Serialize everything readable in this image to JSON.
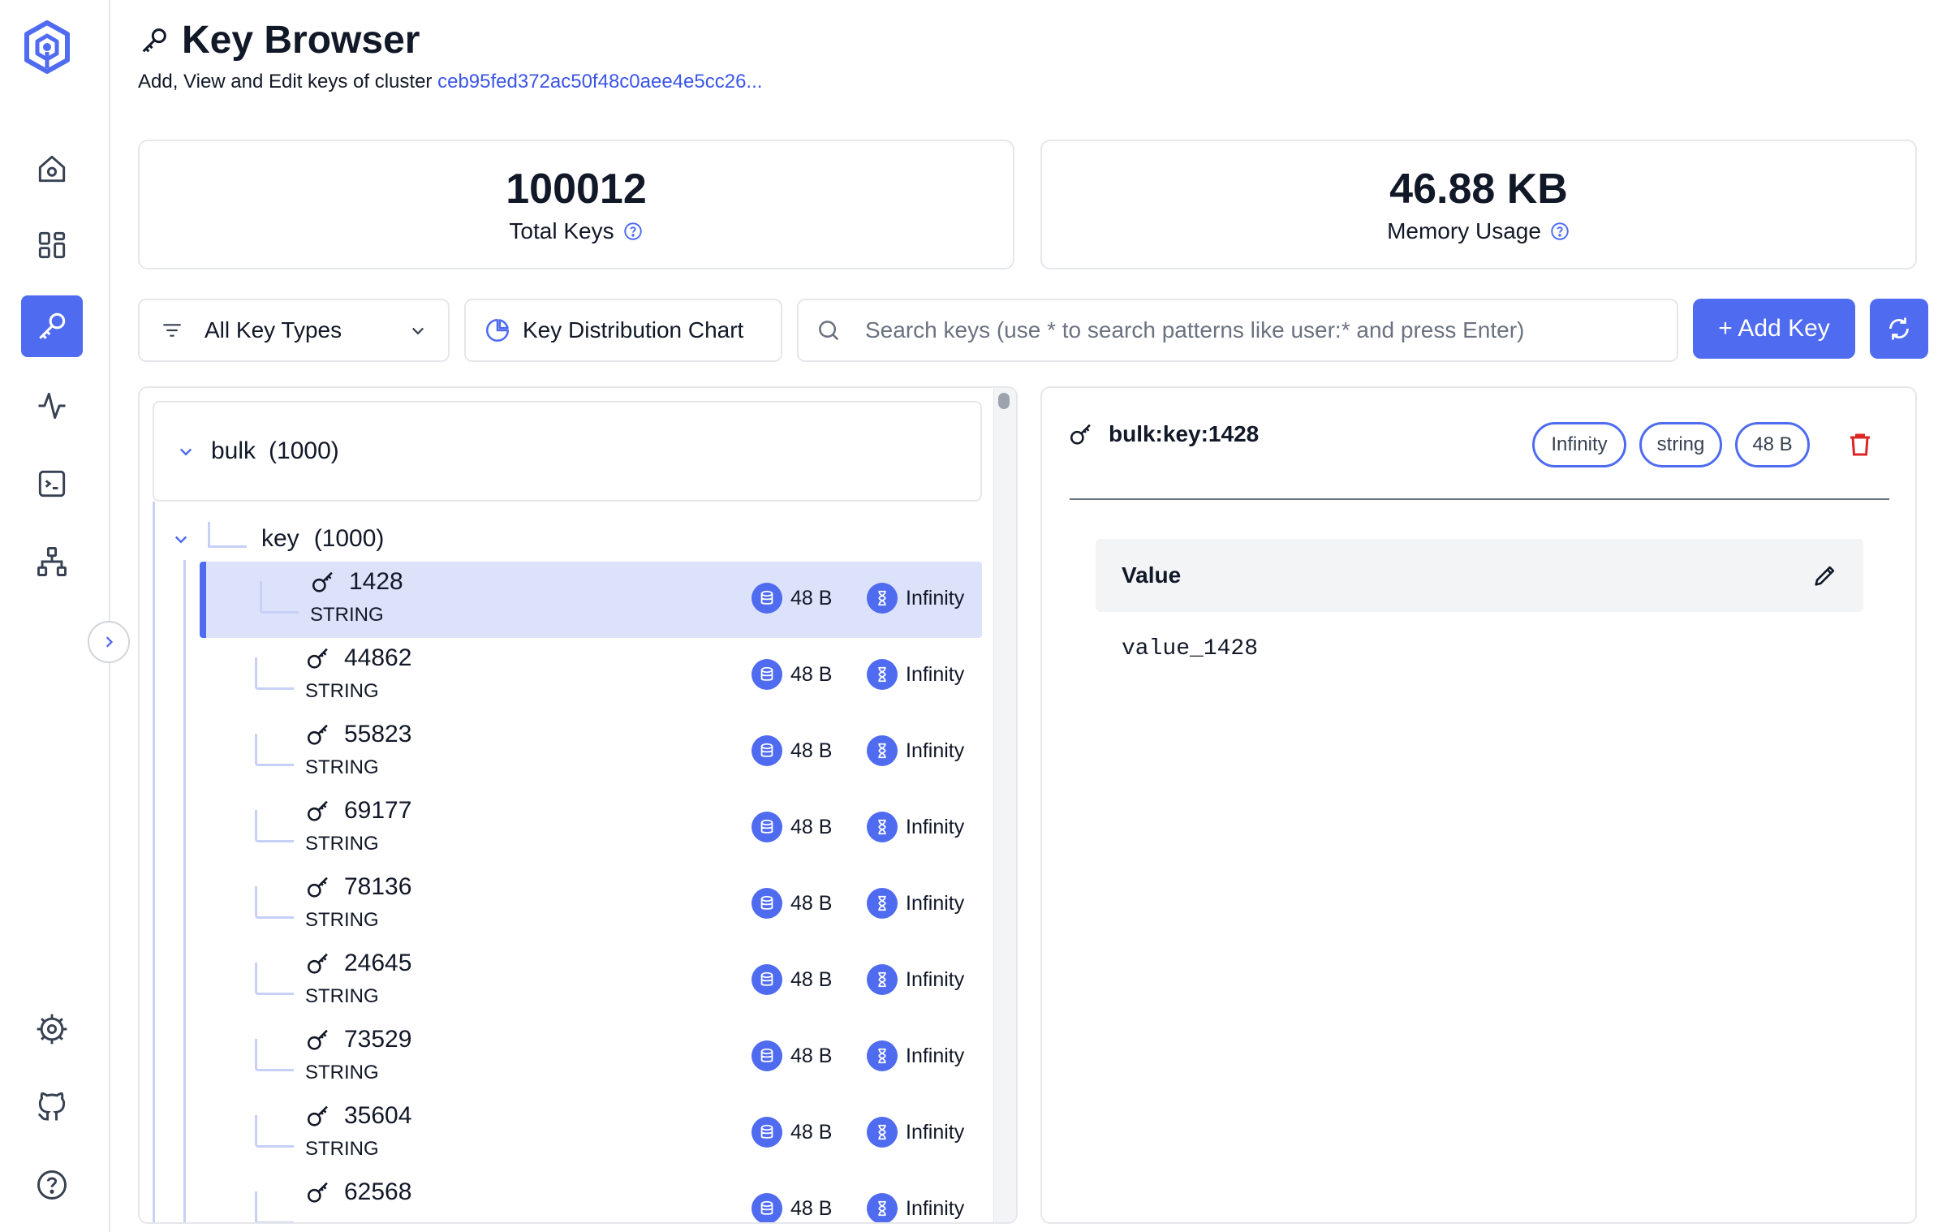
{
  "header": {
    "title": "Key Browser",
    "subtitle": "Add, View and Edit keys of cluster",
    "cluster_id": "ceb95fed372ac50f48c0aee4e5cc26..."
  },
  "stats": {
    "total_keys": "100012",
    "total_keys_label": "Total Keys",
    "memory": "46.88 KB",
    "memory_label": "Memory Usage"
  },
  "toolbar": {
    "key_type_filter": "All Key Types",
    "chart_button": "Key Distribution Chart",
    "search_placeholder": "Search keys (use * to search patterns like user:* and press Enter)",
    "add_key": "+ Add Key"
  },
  "tree": {
    "group": {
      "label": "bulk",
      "count": "(1000)"
    },
    "subgroup": {
      "label": "key",
      "count": "(1000)"
    },
    "keys": [
      {
        "name": "1428",
        "type": "STRING",
        "size": "48 B",
        "ttl": "Infinity",
        "selected": true
      },
      {
        "name": "44862",
        "type": "STRING",
        "size": "48 B",
        "ttl": "Infinity"
      },
      {
        "name": "55823",
        "type": "STRING",
        "size": "48 B",
        "ttl": "Infinity"
      },
      {
        "name": "69177",
        "type": "STRING",
        "size": "48 B",
        "ttl": "Infinity"
      },
      {
        "name": "78136",
        "type": "STRING",
        "size": "48 B",
        "ttl": "Infinity"
      },
      {
        "name": "24645",
        "type": "STRING",
        "size": "48 B",
        "ttl": "Infinity"
      },
      {
        "name": "73529",
        "type": "STRING",
        "size": "48 B",
        "ttl": "Infinity"
      },
      {
        "name": "35604",
        "type": "STRING",
        "size": "48 B",
        "ttl": "Infinity"
      },
      {
        "name": "62568",
        "type": "",
        "size": "48 B",
        "ttl": "Infinity"
      }
    ]
  },
  "detail": {
    "key": "bulk:key:1428",
    "ttl_badge": "Infinity",
    "type_badge": "string",
    "size_badge": "48 B",
    "value_title": "Value",
    "value": "value_1428"
  },
  "colors": {
    "accent": "#4f6bf0",
    "danger": "#dc2626",
    "selected_row": "#dde2fb"
  },
  "icons": {
    "sidebar": [
      "logo-icon",
      "home-icon",
      "dashboard-icon",
      "key-browser-icon",
      "activity-icon",
      "terminal-icon",
      "cluster-topology-icon",
      "settings-icon",
      "github-icon",
      "help-icon"
    ]
  }
}
